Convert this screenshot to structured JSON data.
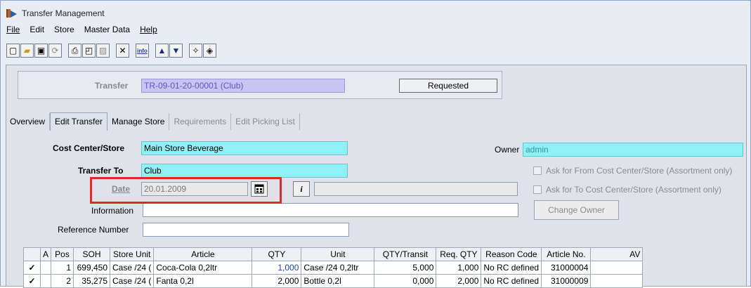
{
  "window": {
    "title": "Transfer Management"
  },
  "menu": [
    "File",
    "Edit",
    "Store",
    "Master Data",
    "Help"
  ],
  "toolbar": [
    {
      "name": "new-icon",
      "glyph": "🗋"
    },
    {
      "name": "open-icon",
      "glyph": "📂"
    },
    {
      "name": "save-icon",
      "glyph": "💾"
    },
    {
      "name": "refresh-icon",
      "glyph": "⟳"
    },
    {
      "name": "print-icon",
      "glyph": "🖶"
    },
    {
      "name": "print-preview-icon",
      "glyph": "🔍"
    },
    {
      "name": "export-icon",
      "glyph": "▣"
    },
    {
      "name": "delete-icon",
      "glyph": "✕"
    },
    {
      "name": "info-icon",
      "glyph": "info"
    },
    {
      "name": "arrow-up-icon",
      "glyph": "▲"
    },
    {
      "name": "arrow-down-icon",
      "glyph": "▼"
    },
    {
      "name": "wand-icon",
      "glyph": "⁂"
    },
    {
      "name": "clear-icon",
      "glyph": "⌫"
    }
  ],
  "header": {
    "transfer_label": "Transfer",
    "transfer_value": "TR-09-01-20-00001  (Club)",
    "status": "Requested"
  },
  "tabs": [
    {
      "label": "Overview",
      "state": "normal"
    },
    {
      "label": "Edit Transfer",
      "state": "active"
    },
    {
      "label": "Manage Store",
      "state": "normal"
    },
    {
      "label": "Requirements",
      "state": "disabled"
    },
    {
      "label": "Edit Picking List",
      "state": "disabled"
    }
  ],
  "form": {
    "cost_center_label": "Cost Center/Store",
    "cost_center_value": "Main Store Beverage",
    "transfer_to_label": "Transfer To",
    "transfer_to_value": "Club",
    "date_label": "Date",
    "date_value": "20.01.2009",
    "information_label": "Information",
    "information_value": "",
    "reference_label": "Reference Number",
    "reference_value": "",
    "owner_label": "Owner",
    "owner_value": "admin",
    "ask_from_label": "Ask for From Cost Center/Store (Assortment only)",
    "ask_to_label": "Ask for To Cost Center/Store (Assortment only)",
    "change_owner_label": "Change Owner",
    "info_button_label": "i",
    "calendar_icon": "calendar-icon"
  },
  "grid": {
    "columns": [
      "",
      "A",
      "Pos",
      "SOH",
      "Store Unit",
      "Article",
      "QTY",
      "Unit",
      "QTY/Transit",
      "Req. QTY",
      "Reason Code",
      "Article No.",
      "AV"
    ],
    "rows": [
      [
        "✓",
        "",
        "1",
        "699,450",
        "Case /24 (",
        "Coca-Cola 0,2ltr",
        "1,000",
        "Case /24 0,2ltr",
        "5,000",
        "1,000",
        "No RC defined",
        "31000004",
        ""
      ],
      [
        "✓",
        "",
        "2",
        "35,275",
        "Case /24 (",
        "Fanta 0,2l",
        "2,000",
        "Bottle 0,2l",
        "0,000",
        "2,000",
        "No RC defined",
        "31000009",
        ""
      ]
    ]
  }
}
